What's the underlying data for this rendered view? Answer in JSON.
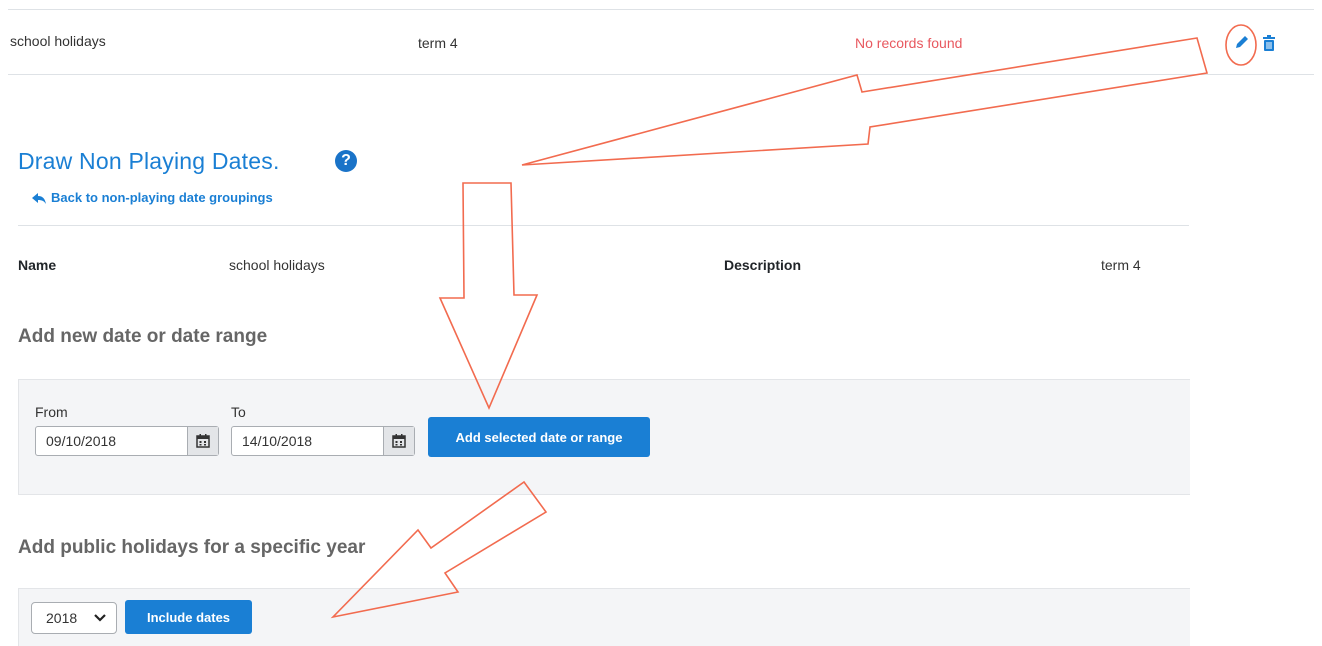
{
  "top_row": {
    "name": "school holidays",
    "description": "term 4",
    "status": "No records found",
    "status_color": "#e8585f"
  },
  "heading": {
    "title": "Draw Non Playing Dates.",
    "help_icon": "?",
    "back_link": "Back to non-playing date groupings"
  },
  "details": {
    "name_label": "Name",
    "name_value": "school holidays",
    "description_label": "Description",
    "description_value": "term 4"
  },
  "add_range": {
    "section_title": "Add new date or date range",
    "from_label": "From",
    "from_value": "09/10/2018",
    "to_label": "To",
    "to_value": "14/10/2018",
    "button": "Add selected date or range"
  },
  "public_holidays": {
    "section_title": "Add public holidays for a specific year",
    "year_value": "2018",
    "button": "Include dates"
  },
  "icons": {
    "edit": "pencil-icon",
    "delete": "trash-icon",
    "back": "reply-arrow-icon",
    "calendar": "calendar-icon",
    "dropdown": "chevron-down-icon",
    "help": "question-circle-icon"
  },
  "colors": {
    "accent": "#1a7fd4",
    "annotation": "#f26b4f"
  }
}
